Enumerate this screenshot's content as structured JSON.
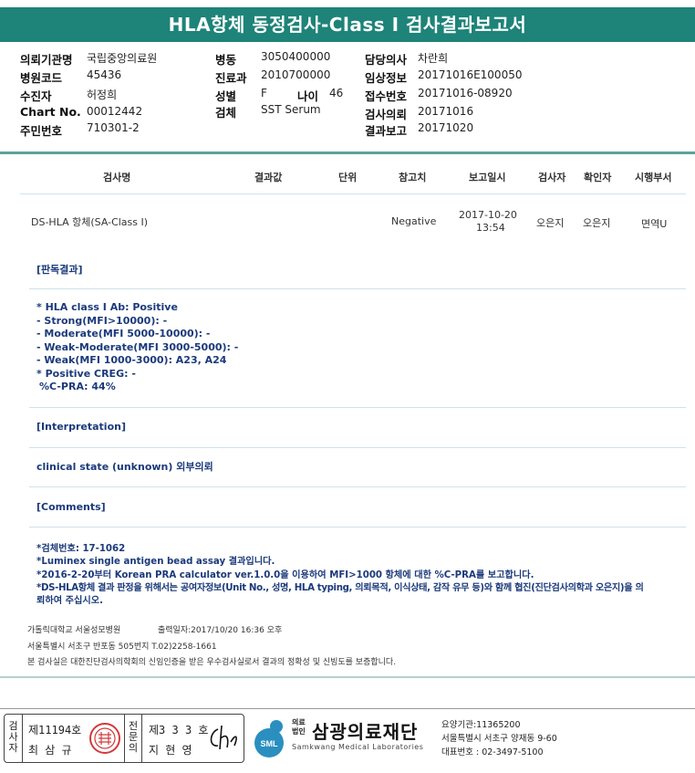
{
  "header": {
    "title": "HLA항체 동정검사-Class I 검사결과보고서"
  },
  "patient_info": {
    "hospital_label": "의뢰기관명",
    "hospital": "국립중앙의료원",
    "code_label": "병원코드",
    "code": "45436",
    "patient_label": "수진자",
    "patient": "허정희",
    "chart_label": "Chart No.",
    "chart": "00012442",
    "rrn_label": "주민번호",
    "rrn": "710301-2",
    "ward_label": "병동",
    "ward": "3050400000",
    "dept_label": "진료과",
    "dept": "2010700000",
    "sex_label": "성별",
    "sex": "F",
    "age_label": "나이",
    "age": "46",
    "specimen_label": "검체",
    "specimen": "SST Serum",
    "doctor_label": "담당의사",
    "doctor": "차란희",
    "clinical_label": "임상정보",
    "clinical": "20171016E100050",
    "accession_label": "접수번호",
    "accession": "20171016-08920",
    "request_label": "검사의뢰",
    "request": "20171016",
    "report_label": "결과보고",
    "report": "20171020"
  },
  "table": {
    "headers": [
      "검사명",
      "결과값",
      "단위",
      "참고치",
      "보고일시",
      "검사자",
      "확인자",
      "시행부서"
    ],
    "row": {
      "test_name": "DS-HLA 항체(SA-Class I)",
      "reference": "Negative",
      "report_date": "2017-10-20",
      "report_time": "13:54",
      "tester": "오은지",
      "confirmer": "오은지",
      "department": "면역U"
    }
  },
  "judgement": {
    "title": "[판독결과]",
    "lines": [
      "* HLA class I Ab: Positive",
      "- Strong(MFI>10000): -",
      "- Moderate(MFI 5000-10000): -",
      "- Weak-Moderate(MFI 3000-5000): -",
      "- Weak(MFI 1000-3000): A23, A24",
      "* Positive CREG: -",
      " %C-PRA: 44%"
    ]
  },
  "interpretation": {
    "title": "[Interpretation]",
    "text": "clinical state (unknown) 외부의뢰"
  },
  "comments": {
    "title": "[Comments]",
    "lines": [
      "*검체번호: 17-1062",
      "*Luminex single antigen bead assay 결과입니다.",
      "*2016-2-20부터 Korean PRA calculator ver.1.0.0을 이용하여 MFI>1000 항체에 대한 %C-PRA를 보고합니다.",
      "*DS-HLA항체 결과 판정을 위해서는 공여자정보(Unit No., 성명, HLA typing, 의뢰목적, 이식상태, 감작 유무 등)와 함께 협진(진단검사의학과 오은지)을 의",
      "뢰하여 주십시오."
    ]
  },
  "footer": {
    "university": "가톨릭대학교 서울성모병원",
    "printed": "출력일자:2017/10/20 16:36 오후",
    "address": "서울특별시 서초구 반포동 505번지 T.02)2258-1661",
    "certification": "본 검사실은 대한진단검사의학회의 신임인증을 받은 우수검사실로서 결과의 정확성 및 신빙도를 보증합니다."
  },
  "signature": {
    "col1_label": "검사자",
    "col1_no": "제11194호",
    "col1_name": "최 삼 규",
    "col2_label": "전문의",
    "col2_no": "제3 3 3 호",
    "col2_name": "지 현 영"
  },
  "institution": {
    "prefix": "의료법인",
    "name": "삼광의료재단",
    "english": "Samkwang Medical Laboratories",
    "logo_text": "SML",
    "care_code": "요양기관:11365200",
    "address": "서울특별시 서초구 양재동 9-60",
    "phone": "대표번호 : 02-3497-5100"
  },
  "colors": {
    "header": "#1e8378",
    "comment_text": "#1b3a7a",
    "seal": "#d23a3a"
  }
}
